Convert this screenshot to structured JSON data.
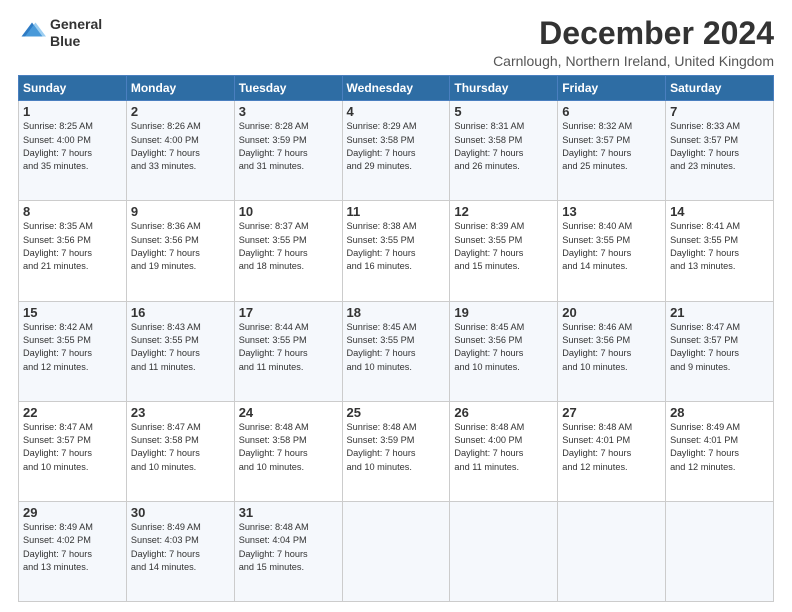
{
  "logo": {
    "line1": "General",
    "line2": "Blue"
  },
  "title": "December 2024",
  "subtitle": "Carnlough, Northern Ireland, United Kingdom",
  "days_of_week": [
    "Sunday",
    "Monday",
    "Tuesday",
    "Wednesday",
    "Thursday",
    "Friday",
    "Saturday"
  ],
  "weeks": [
    [
      {
        "day": "1",
        "info": "Sunrise: 8:25 AM\nSunset: 4:00 PM\nDaylight: 7 hours\nand 35 minutes."
      },
      {
        "day": "2",
        "info": "Sunrise: 8:26 AM\nSunset: 4:00 PM\nDaylight: 7 hours\nand 33 minutes."
      },
      {
        "day": "3",
        "info": "Sunrise: 8:28 AM\nSunset: 3:59 PM\nDaylight: 7 hours\nand 31 minutes."
      },
      {
        "day": "4",
        "info": "Sunrise: 8:29 AM\nSunset: 3:58 PM\nDaylight: 7 hours\nand 29 minutes."
      },
      {
        "day": "5",
        "info": "Sunrise: 8:31 AM\nSunset: 3:58 PM\nDaylight: 7 hours\nand 26 minutes."
      },
      {
        "day": "6",
        "info": "Sunrise: 8:32 AM\nSunset: 3:57 PM\nDaylight: 7 hours\nand 25 minutes."
      },
      {
        "day": "7",
        "info": "Sunrise: 8:33 AM\nSunset: 3:57 PM\nDaylight: 7 hours\nand 23 minutes."
      }
    ],
    [
      {
        "day": "8",
        "info": "Sunrise: 8:35 AM\nSunset: 3:56 PM\nDaylight: 7 hours\nand 21 minutes."
      },
      {
        "day": "9",
        "info": "Sunrise: 8:36 AM\nSunset: 3:56 PM\nDaylight: 7 hours\nand 19 minutes."
      },
      {
        "day": "10",
        "info": "Sunrise: 8:37 AM\nSunset: 3:55 PM\nDaylight: 7 hours\nand 18 minutes."
      },
      {
        "day": "11",
        "info": "Sunrise: 8:38 AM\nSunset: 3:55 PM\nDaylight: 7 hours\nand 16 minutes."
      },
      {
        "day": "12",
        "info": "Sunrise: 8:39 AM\nSunset: 3:55 PM\nDaylight: 7 hours\nand 15 minutes."
      },
      {
        "day": "13",
        "info": "Sunrise: 8:40 AM\nSunset: 3:55 PM\nDaylight: 7 hours\nand 14 minutes."
      },
      {
        "day": "14",
        "info": "Sunrise: 8:41 AM\nSunset: 3:55 PM\nDaylight: 7 hours\nand 13 minutes."
      }
    ],
    [
      {
        "day": "15",
        "info": "Sunrise: 8:42 AM\nSunset: 3:55 PM\nDaylight: 7 hours\nand 12 minutes."
      },
      {
        "day": "16",
        "info": "Sunrise: 8:43 AM\nSunset: 3:55 PM\nDaylight: 7 hours\nand 11 minutes."
      },
      {
        "day": "17",
        "info": "Sunrise: 8:44 AM\nSunset: 3:55 PM\nDaylight: 7 hours\nand 11 minutes."
      },
      {
        "day": "18",
        "info": "Sunrise: 8:45 AM\nSunset: 3:55 PM\nDaylight: 7 hours\nand 10 minutes."
      },
      {
        "day": "19",
        "info": "Sunrise: 8:45 AM\nSunset: 3:56 PM\nDaylight: 7 hours\nand 10 minutes."
      },
      {
        "day": "20",
        "info": "Sunrise: 8:46 AM\nSunset: 3:56 PM\nDaylight: 7 hours\nand 10 minutes."
      },
      {
        "day": "21",
        "info": "Sunrise: 8:47 AM\nSunset: 3:57 PM\nDaylight: 7 hours\nand 9 minutes."
      }
    ],
    [
      {
        "day": "22",
        "info": "Sunrise: 8:47 AM\nSunset: 3:57 PM\nDaylight: 7 hours\nand 10 minutes."
      },
      {
        "day": "23",
        "info": "Sunrise: 8:47 AM\nSunset: 3:58 PM\nDaylight: 7 hours\nand 10 minutes."
      },
      {
        "day": "24",
        "info": "Sunrise: 8:48 AM\nSunset: 3:58 PM\nDaylight: 7 hours\nand 10 minutes."
      },
      {
        "day": "25",
        "info": "Sunrise: 8:48 AM\nSunset: 3:59 PM\nDaylight: 7 hours\nand 10 minutes."
      },
      {
        "day": "26",
        "info": "Sunrise: 8:48 AM\nSunset: 4:00 PM\nDaylight: 7 hours\nand 11 minutes."
      },
      {
        "day": "27",
        "info": "Sunrise: 8:48 AM\nSunset: 4:01 PM\nDaylight: 7 hours\nand 12 minutes."
      },
      {
        "day": "28",
        "info": "Sunrise: 8:49 AM\nSunset: 4:01 PM\nDaylight: 7 hours\nand 12 minutes."
      }
    ],
    [
      {
        "day": "29",
        "info": "Sunrise: 8:49 AM\nSunset: 4:02 PM\nDaylight: 7 hours\nand 13 minutes."
      },
      {
        "day": "30",
        "info": "Sunrise: 8:49 AM\nSunset: 4:03 PM\nDaylight: 7 hours\nand 14 minutes."
      },
      {
        "day": "31",
        "info": "Sunrise: 8:48 AM\nSunset: 4:04 PM\nDaylight: 7 hours\nand 15 minutes."
      },
      null,
      null,
      null,
      null
    ]
  ]
}
